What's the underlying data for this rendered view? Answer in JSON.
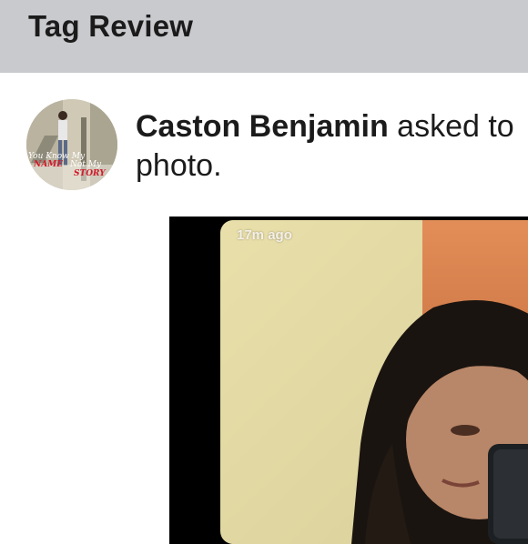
{
  "header": {
    "title": "Tag Review"
  },
  "request": {
    "user_name": "Caston Benjamin",
    "message": "asked to",
    "message_cont": "photo."
  },
  "avatar": {
    "line1": "You Know My",
    "line2": "NAME",
    "line3": "Not My",
    "line4": "STORY"
  },
  "photo": {
    "timestamp": "17m ago"
  }
}
